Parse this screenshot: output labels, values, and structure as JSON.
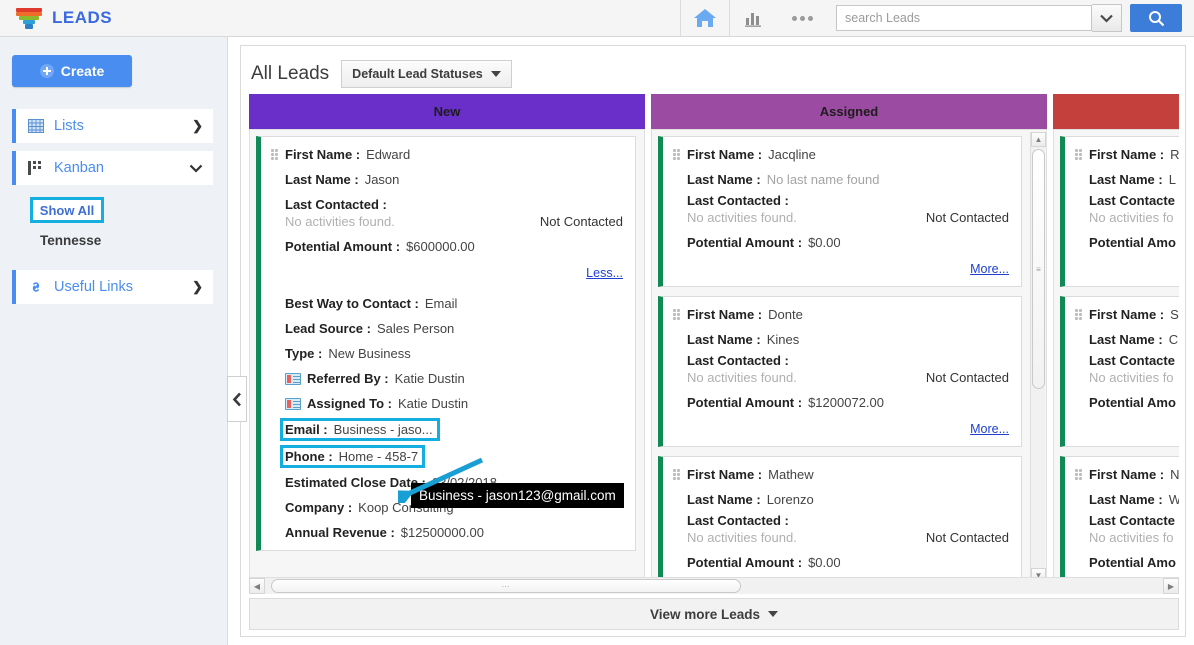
{
  "app": {
    "brand": "LEADS",
    "brand_color": "#3b6ae0"
  },
  "topbar": {
    "home_icon": "home-icon",
    "reports_icon": "bar-chart-icon",
    "more_icon": "more-dots-icon",
    "search_placeholder": "search Leads",
    "search_value": "",
    "dropdown_icon": "chevron-down-icon",
    "go_icon": "search-icon"
  },
  "sidebar": {
    "create_label": "Create",
    "items": [
      {
        "label": "Lists",
        "icon": "grid-table-icon",
        "chevron": "❯"
      },
      {
        "label": "Kanban",
        "icon": "kanban-icon",
        "chevron": "⌄"
      },
      {
        "label": "Useful Links",
        "icon": "link-icon",
        "chevron": "❯"
      }
    ],
    "show_all_label": "Show All",
    "saved_view_label": "Tennesse"
  },
  "main": {
    "page_title": "All Leads",
    "status_filter": "Default Lead Statuses",
    "collapse_icon": "chevron-left-icon",
    "view_more_label": "View more Leads"
  },
  "board": {
    "columns": [
      {
        "name": "New",
        "color": "#6a2ec9",
        "cards": [
          {
            "first_name_label": "First Name :",
            "first_name": "Edward",
            "last_name_label": "Last Name :",
            "last_name": "Jason",
            "last_contacted_label": "Last Contacted :",
            "activities": "No activities found.",
            "contact_status": "Not Contacted",
            "potential_label": "Potential Amount :",
            "potential": "$600000.00",
            "toggle_label": "Less...",
            "expanded": [
              {
                "label": "Best Way to Contact :",
                "value": "Email"
              },
              {
                "label": "Lead Source :",
                "value": "Sales Person"
              },
              {
                "label": "Type :",
                "value": "New Business"
              },
              {
                "label": "Referred By :",
                "value": "Katie Dustin",
                "icon": "contact-card-icon"
              },
              {
                "label": "Assigned To :",
                "value": "Katie Dustin",
                "icon": "contact-card-icon"
              },
              {
                "label": "Email :",
                "value": "Business - jaso...",
                "highlight": true
              },
              {
                "label": "Phone :",
                "value": "Home - 458-7",
                "highlight": true
              },
              {
                "label": "Estimated Close Date :",
                "value": "03/02/2018"
              },
              {
                "label": "Company :",
                "value": "Koop Consulting"
              },
              {
                "label": "Annual Revenue :",
                "value": "$12500000.00"
              }
            ]
          }
        ]
      },
      {
        "name": "Assigned",
        "color": "#9c4ba3",
        "cards": [
          {
            "first_name_label": "First Name :",
            "first_name": "Jacqline",
            "last_name_label": "Last Name :",
            "last_name": "No last name found",
            "last_name_muted": true,
            "last_contacted_label": "Last Contacted :",
            "activities": "No activities found.",
            "contact_status": "Not Contacted",
            "potential_label": "Potential Amount :",
            "potential": "$0.00",
            "toggle_label": "More..."
          },
          {
            "first_name_label": "First Name :",
            "first_name": "Donte",
            "last_name_label": "Last Name :",
            "last_name": "Kines",
            "last_contacted_label": "Last Contacted :",
            "activities": "No activities found.",
            "contact_status": "Not Contacted",
            "potential_label": "Potential Amount :",
            "potential": "$1200072.00",
            "toggle_label": "More..."
          },
          {
            "first_name_label": "First Name :",
            "first_name": "Mathew",
            "last_name_label": "Last Name :",
            "last_name": "Lorenzo",
            "last_contacted_label": "Last Contacted :",
            "activities": "No activities found.",
            "contact_status": "Not Contacted",
            "potential_label": "Potential Amount :",
            "potential": "$0.00",
            "toggle_label": ""
          }
        ]
      },
      {
        "name": "",
        "color": "#c4403c",
        "cards": [
          {
            "first_name_label": "First Name :",
            "first_name": "R",
            "last_name_label": "Last Name :",
            "last_name": "L",
            "last_contacted_label": "Last Contacte",
            "activities": "No activities fo",
            "contact_status": "",
            "potential_label": "Potential Amo",
            "potential": "",
            "toggle_label": ""
          },
          {
            "first_name_label": "First Name :",
            "first_name": "S",
            "last_name_label": "Last Name :",
            "last_name": "C",
            "last_contacted_label": "Last Contacte",
            "activities": "No activities fo",
            "contact_status": "",
            "potential_label": "Potential Amo",
            "potential": "",
            "toggle_label": ""
          },
          {
            "first_name_label": "First Name :",
            "first_name": "N",
            "last_name_label": "Last Name :",
            "last_name": "W",
            "last_contacted_label": "Last Contacte",
            "activities": "No activities fo",
            "contact_status": "",
            "potential_label": "Potential Amo",
            "potential": "",
            "toggle_label": ""
          }
        ]
      }
    ]
  },
  "annotation": {
    "tooltip_text": "Business - jason123@gmail.com",
    "arrow_color": "#1a9fd4",
    "highlight_color": "#14aee0"
  }
}
